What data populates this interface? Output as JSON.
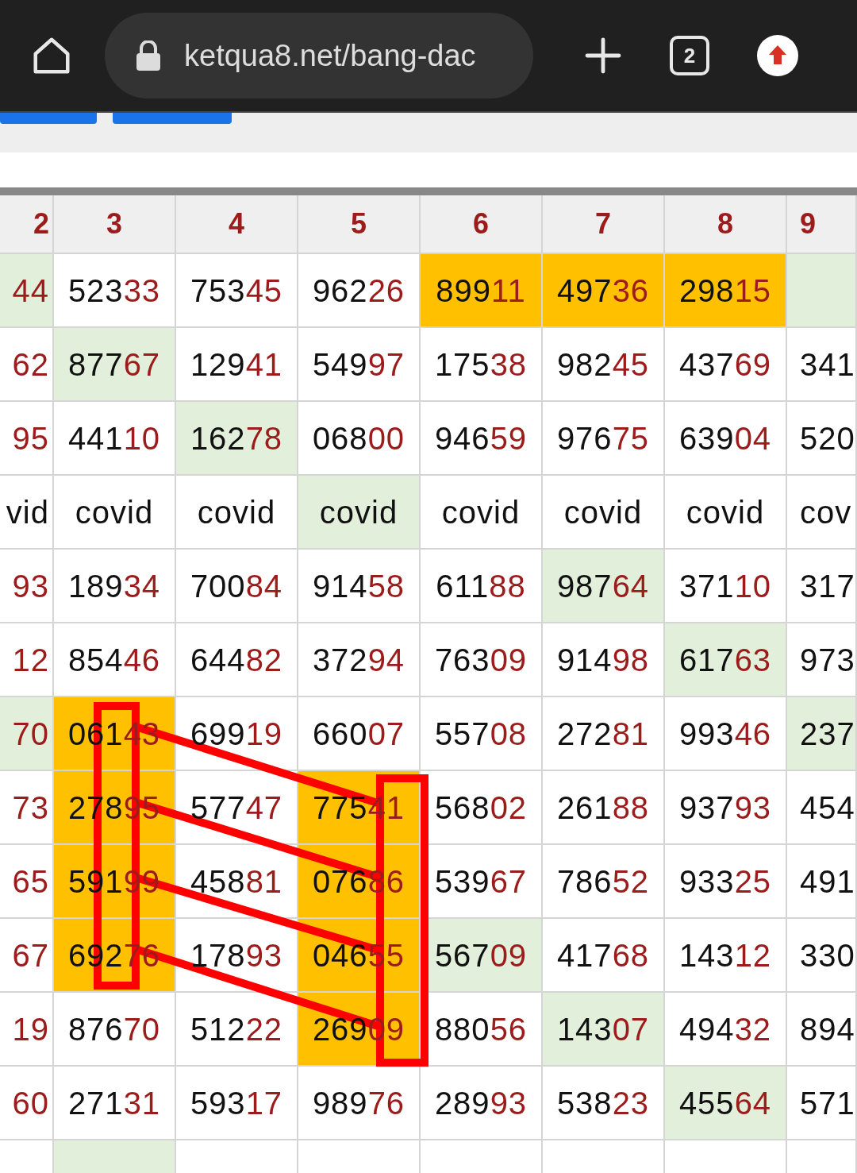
{
  "browser": {
    "url": "ketqua8.net/bang-dac",
    "tab_count": "2"
  },
  "table": {
    "columns": [
      {
        "label": "2"
      },
      {
        "label": "3"
      },
      {
        "label": "4"
      },
      {
        "label": "5"
      },
      {
        "label": "6"
      },
      {
        "label": "7"
      },
      {
        "label": "8"
      },
      {
        "label": "9"
      }
    ],
    "rows": [
      {
        "cells": [
          {
            "tail": "44",
            "color": "#e2efda"
          },
          {
            "main": "523",
            "tail": "33"
          },
          {
            "main": "753",
            "tail": "45"
          },
          {
            "main": "962",
            "tail": "26"
          },
          {
            "main": "899",
            "tail": "11",
            "color": "#ffc000"
          },
          {
            "main": "497",
            "tail": "36",
            "color": "#ffc000"
          },
          {
            "main": "298",
            "tail": "15",
            "color": "#ffc000"
          },
          {
            "color": "#e2efda"
          }
        ]
      },
      {
        "cells": [
          {
            "tail": "62"
          },
          {
            "main": "877",
            "tail": "67",
            "color": "#e2efda"
          },
          {
            "main": "129",
            "tail": "41"
          },
          {
            "main": "549",
            "tail": "97"
          },
          {
            "main": "175",
            "tail": "38"
          },
          {
            "main": "982",
            "tail": "45"
          },
          {
            "main": "437",
            "tail": "69"
          },
          {
            "main": "341"
          }
        ]
      },
      {
        "cells": [
          {
            "tail": "95"
          },
          {
            "main": "441",
            "tail": "10"
          },
          {
            "main": "162",
            "tail": "78",
            "color": "#e2efda"
          },
          {
            "main": "068",
            "tail": "00"
          },
          {
            "main": "946",
            "tail": "59"
          },
          {
            "main": "976",
            "tail": "75"
          },
          {
            "main": "639",
            "tail": "04"
          },
          {
            "main": "520"
          }
        ]
      },
      {
        "cells": [
          {
            "main": "vid"
          },
          {
            "main": "covid"
          },
          {
            "main": "covid"
          },
          {
            "main": "covid",
            "color": "#e2efda"
          },
          {
            "main": "covid"
          },
          {
            "main": "covid"
          },
          {
            "main": "covid"
          },
          {
            "main": "cov"
          }
        ]
      },
      {
        "cells": [
          {
            "tail": "93"
          },
          {
            "main": "189",
            "tail": "34"
          },
          {
            "main": "700",
            "tail": "84"
          },
          {
            "main": "914",
            "tail": "58"
          },
          {
            "main": "611",
            "tail": "88"
          },
          {
            "main": "987",
            "tail": "64",
            "color": "#e2efda"
          },
          {
            "main": "371",
            "tail": "10"
          },
          {
            "main": "317"
          }
        ]
      },
      {
        "cells": [
          {
            "tail": "12"
          },
          {
            "main": "854",
            "tail": "46"
          },
          {
            "main": "644",
            "tail": "82"
          },
          {
            "main": "372",
            "tail": "94"
          },
          {
            "main": "763",
            "tail": "09"
          },
          {
            "main": "914",
            "tail": "98"
          },
          {
            "main": "617",
            "tail": "63",
            "color": "#e2efda"
          },
          {
            "main": "973"
          }
        ]
      },
      {
        "cells": [
          {
            "tail": "70",
            "color": "#e2efda"
          },
          {
            "main": "061",
            "tail": "43",
            "color": "#ffc000"
          },
          {
            "main": "699",
            "tail": "19"
          },
          {
            "main": "660",
            "tail": "07"
          },
          {
            "main": "557",
            "tail": "08"
          },
          {
            "main": "272",
            "tail": "81"
          },
          {
            "main": "993",
            "tail": "46"
          },
          {
            "main": "237",
            "color": "#e2efda"
          }
        ]
      },
      {
        "cells": [
          {
            "tail": "73"
          },
          {
            "main": "278",
            "tail": "95",
            "color": "#ffc000"
          },
          {
            "main": "577",
            "tail": "47"
          },
          {
            "main": "775",
            "tail": "41",
            "color": "#ffc000"
          },
          {
            "main": "568",
            "tail": "02"
          },
          {
            "main": "261",
            "tail": "88"
          },
          {
            "main": "937",
            "tail": "93"
          },
          {
            "main": "454"
          }
        ]
      },
      {
        "cells": [
          {
            "tail": "65"
          },
          {
            "main": "591",
            "tail": "99",
            "color": "#ffc000"
          },
          {
            "main": "458",
            "tail": "81"
          },
          {
            "main": "076",
            "tail": "86",
            "color": "#ffc000"
          },
          {
            "main": "539",
            "tail": "67"
          },
          {
            "main": "786",
            "tail": "52"
          },
          {
            "main": "933",
            "tail": "25"
          },
          {
            "main": "491"
          }
        ]
      },
      {
        "cells": [
          {
            "tail": "67"
          },
          {
            "main": "692",
            "tail": "76",
            "color": "#ffc000"
          },
          {
            "main": "178",
            "tail": "93"
          },
          {
            "main": "046",
            "tail": "55",
            "color": "#ffc000"
          },
          {
            "main": "567",
            "tail": "09",
            "color": "#e2efda"
          },
          {
            "main": "417",
            "tail": "68"
          },
          {
            "main": "143",
            "tail": "12"
          },
          {
            "main": "330"
          }
        ]
      },
      {
        "cells": [
          {
            "tail": "19"
          },
          {
            "main": "876",
            "tail": "70"
          },
          {
            "main": "512",
            "tail": "22"
          },
          {
            "main": "269",
            "tail": "09",
            "color": "#ffc000"
          },
          {
            "main": "880",
            "tail": "56"
          },
          {
            "main": "143",
            "tail": "07",
            "color": "#e2efda"
          },
          {
            "main": "494",
            "tail": "32"
          },
          {
            "main": "894"
          }
        ]
      },
      {
        "cells": [
          {
            "tail": "60"
          },
          {
            "main": "271",
            "tail": "31"
          },
          {
            "main": "593",
            "tail": "17"
          },
          {
            "main": "989",
            "tail": "76"
          },
          {
            "main": "289",
            "tail": "93"
          },
          {
            "main": "538",
            "tail": "23"
          },
          {
            "main": "455",
            "tail": "64",
            "color": "#e2efda"
          },
          {
            "main": "571"
          }
        ]
      },
      {
        "cells": [
          {},
          {
            "color": "#e2efda"
          },
          {},
          {},
          {},
          {},
          {},
          {}
        ]
      }
    ]
  }
}
